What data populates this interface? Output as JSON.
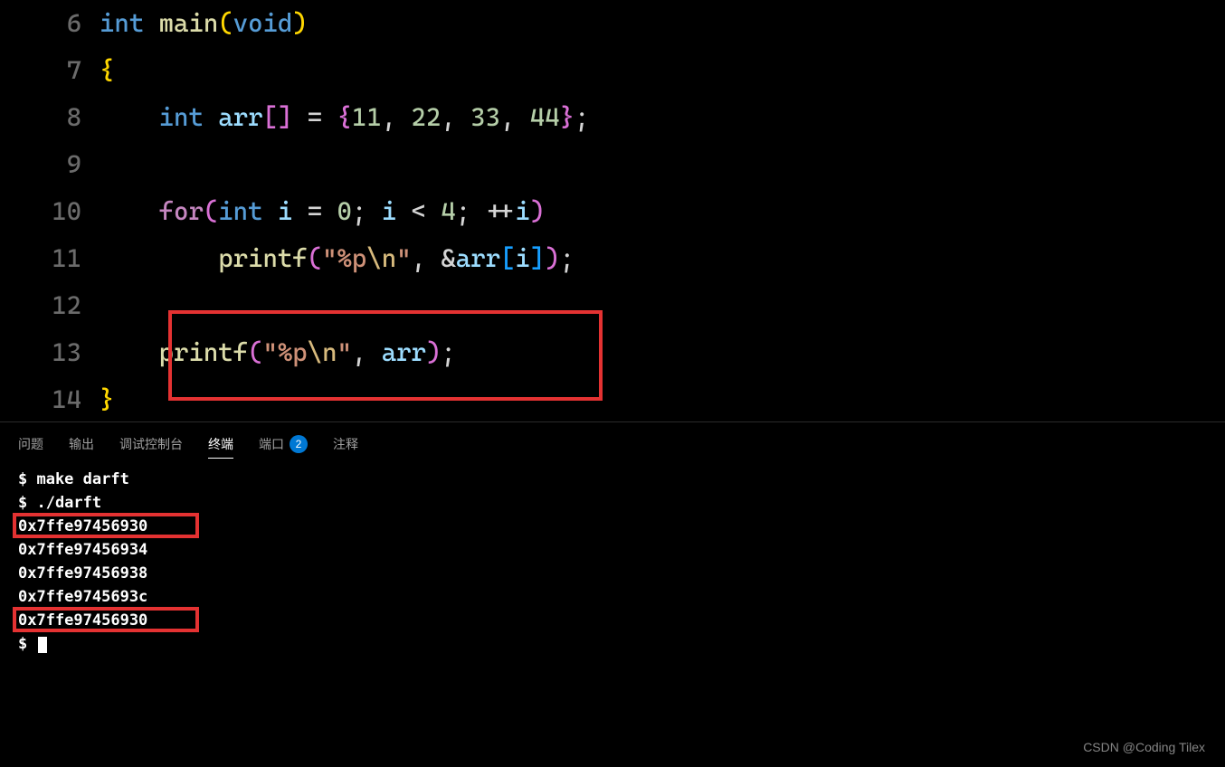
{
  "code": {
    "lines": [
      6,
      7,
      8,
      9,
      10,
      11,
      12,
      13,
      14
    ],
    "l6": {
      "int": "int",
      "main": "main",
      "void": "void"
    },
    "l7": {
      "brace": "{"
    },
    "l8": {
      "int": "int",
      "arr": "arr",
      "eq": " = ",
      "v1": "11",
      "v2": "22",
      "v3": "33",
      "v4": "44"
    },
    "l10": {
      "for": "for",
      "int": "int",
      "i": "i",
      "eq": " = ",
      "zero": "0",
      "lt": " < ",
      "four": "4",
      "pp": "++"
    },
    "l11": {
      "printf": "printf",
      "str_open": "\"",
      "fmt": "%p",
      "esc": "\\n",
      "str_close": "\"",
      "amp": "&",
      "arr": "arr",
      "i": "i"
    },
    "l13": {
      "printf": "printf",
      "str_open": "\"",
      "fmt": "%p",
      "esc": "\\n",
      "str_close": "\"",
      "arr": "arr"
    },
    "l14": {
      "brace": "}"
    }
  },
  "tabs": {
    "problems": "问题",
    "output": "输出",
    "debug": "调试控制台",
    "terminal": "终端",
    "ports": "端口",
    "ports_badge": "2",
    "comments": "注释"
  },
  "terminal": {
    "cmd1": "$ make darft",
    "cmd2": "$ ./darft",
    "out1": "0x7ffe97456930",
    "out2": "0x7ffe97456934",
    "out3": "0x7ffe97456938",
    "out4": "0x7ffe9745693c",
    "out5": "0x7ffe97456930",
    "prompt": "$ "
  },
  "watermark": "CSDN @Coding Tilex"
}
